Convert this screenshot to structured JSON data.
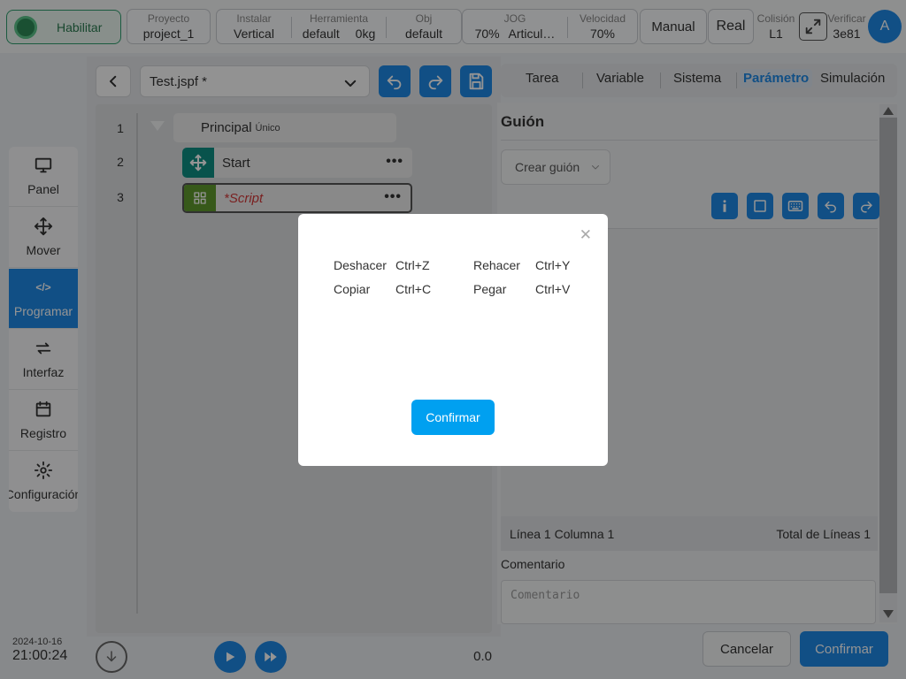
{
  "topbar": {
    "enable_label": "Habilitar",
    "project": {
      "caption": "Proyecto",
      "value": "project_1"
    },
    "install": {
      "caption": "Instalar",
      "value": "Vertical"
    },
    "tool": {
      "caption": "Herramienta",
      "value": "default",
      "load": "0kg"
    },
    "obj": {
      "caption": "Obj",
      "value": "default"
    },
    "jog": {
      "caption": "JOG",
      "percent": "70%",
      "mode": "Articul…"
    },
    "speed": {
      "caption": "Velocidad",
      "value": "70%"
    },
    "manual_label": "Manual",
    "real_label": "Real",
    "collision": {
      "caption": "Colisión",
      "value": "L1"
    },
    "verify": {
      "caption": "Verificar",
      "value": "3e81"
    },
    "avatar_initial": "A"
  },
  "sidebar": {
    "items": [
      {
        "label": "Panel",
        "icon": "monitor-icon"
      },
      {
        "label": "Mover",
        "icon": "move-icon"
      },
      {
        "label": "Programar",
        "icon": "code-icon",
        "active": true
      },
      {
        "label": "Interfaz",
        "icon": "swap-icon"
      },
      {
        "label": "Registro",
        "icon": "calendar-icon"
      },
      {
        "label": "Configuración",
        "icon": "gear-icon"
      }
    ],
    "date": "2024-10-16",
    "time": "21:00:24"
  },
  "program": {
    "file_name": "Test.jspf *",
    "lines": [
      "1",
      "2",
      "3"
    ],
    "main_node": {
      "label": "Principal",
      "suffix": "Único"
    },
    "nodes": [
      {
        "label": "Start",
        "color": "#0e8f83",
        "icon": "move-icon"
      },
      {
        "label": "*Script",
        "color": "#5f9a2e",
        "icon": "grid-icon"
      }
    ],
    "speed_value": "0.0"
  },
  "tabs": [
    {
      "label": "Tarea"
    },
    {
      "label": "Variable"
    },
    {
      "label": "Sistema"
    },
    {
      "label": "Parámetro",
      "active": true
    },
    {
      "label": "Simulación"
    }
  ],
  "script_panel": {
    "title": "Guión",
    "create_placeholder": "Crear guión",
    "status_left": "Línea 1 Columna 1",
    "status_right": "Total de Líneas 1",
    "comment_label": "Comentario",
    "comment_placeholder": "Comentario",
    "cancel_label": "Cancelar",
    "confirm_label": "Confirmar"
  },
  "modal": {
    "shortcuts": [
      {
        "action": "Deshacer",
        "keys": "Ctrl+Z",
        "action2": "Rehacer",
        "keys2": "Ctrl+Y"
      },
      {
        "action": "Copiar",
        "keys": "Ctrl+C",
        "action2": "Pegar",
        "keys2": "Ctrl+V"
      }
    ],
    "confirm_label": "Confirmar"
  },
  "colors": {
    "accent": "#1e88e5",
    "enable_green": "#2e8b57",
    "modal_button": "#00a0f0",
    "script_red": "#d23a3a"
  }
}
